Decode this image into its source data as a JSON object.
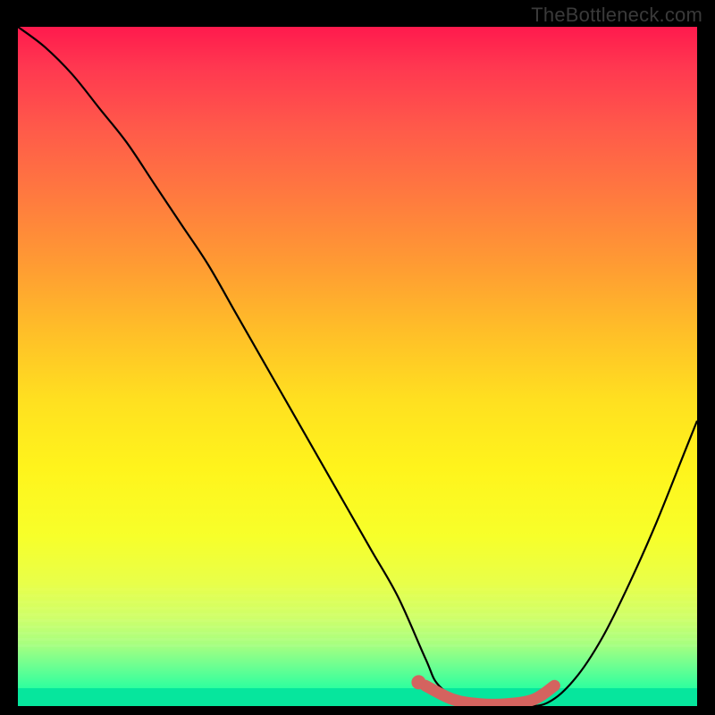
{
  "attribution": "TheBottleneck.com",
  "chart_data": {
    "type": "line",
    "title": "",
    "xlabel": "",
    "ylabel": "",
    "xlim": [
      0,
      100
    ],
    "ylim": [
      0,
      100
    ],
    "series": [
      {
        "name": "curve",
        "x": [
          0,
          4,
          8,
          12,
          16,
          20,
          24,
          28,
          32,
          36,
          40,
          44,
          48,
          52,
          56,
          60,
          62,
          66,
          70,
          74,
          78,
          82,
          86,
          90,
          94,
          98,
          100
        ],
        "y": [
          100,
          97,
          93,
          88,
          83,
          77,
          71,
          65,
          58,
          51,
          44,
          37,
          30,
          23,
          16,
          7,
          3,
          0.5,
          0,
          0,
          0.5,
          4,
          10,
          18,
          27,
          37,
          42
        ]
      }
    ],
    "highlight": {
      "x": [
        60,
        64,
        68,
        72,
        76,
        79
      ],
      "y": [
        3,
        1,
        0.3,
        0.3,
        1,
        3
      ],
      "dot": {
        "x": 59,
        "y": 3.5
      }
    },
    "gradient_colors": {
      "top": "#ff1a4d",
      "mid": "#ffe020",
      "bottom": "#08ffa6"
    }
  }
}
